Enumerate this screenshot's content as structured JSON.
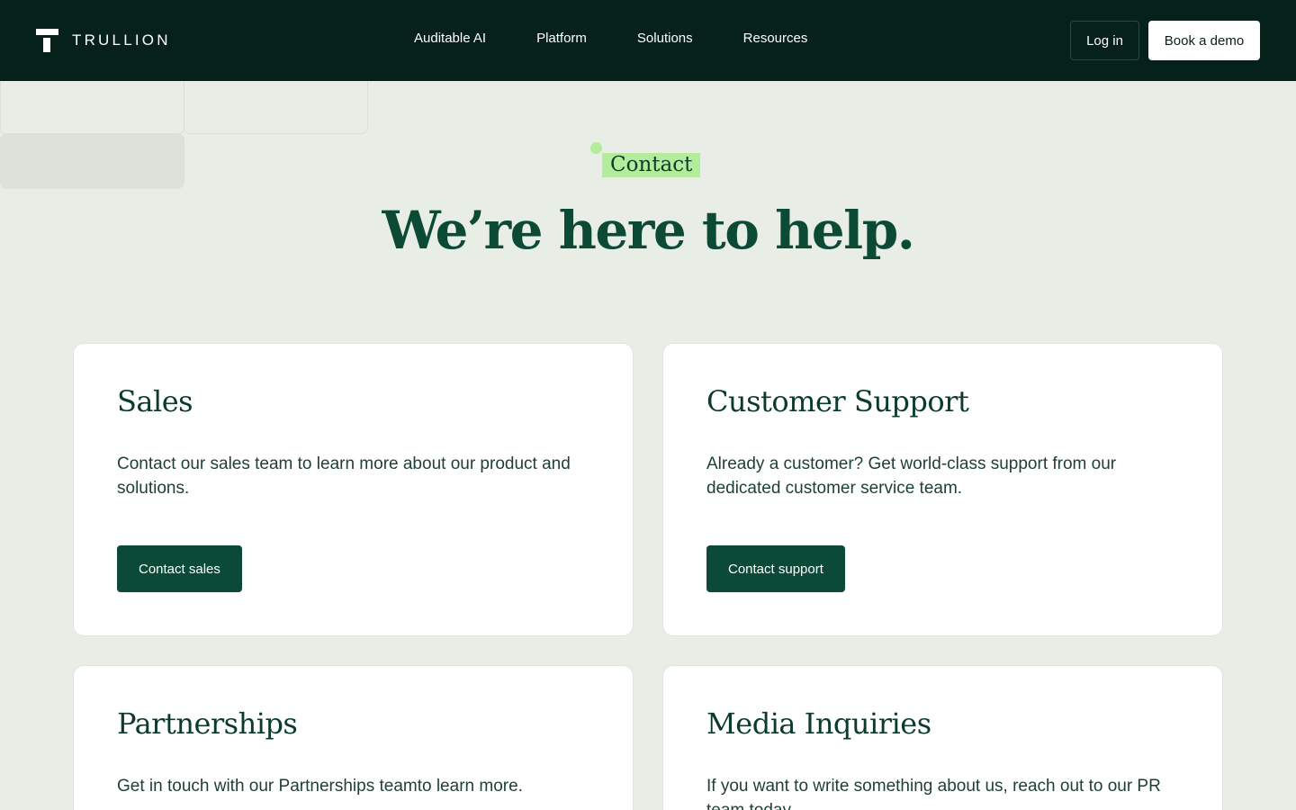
{
  "brand": {
    "name": "TRULLION"
  },
  "nav": {
    "items": [
      "Auditable AI",
      "Platform",
      "Solutions",
      "Resources"
    ],
    "login_label": "Log in",
    "demo_label": "Book a demo"
  },
  "hero": {
    "eyebrow": "Contact",
    "title": "We’re here to help."
  },
  "cards": [
    {
      "title": "Sales",
      "text": "Contact our sales team to learn more about our product and solutions.",
      "cta": "Contact sales"
    },
    {
      "title": "Customer Support",
      "text": "Already a customer? Get world-class support from our dedicated customer service team.",
      "cta": "Contact support"
    },
    {
      "title": "Partnerships",
      "text": "Get in touch with our Partnerships teamto learn more."
    },
    {
      "title": "Media Inquiries",
      "text": "If you want to write something about us, reach out to our PR team today."
    }
  ],
  "colors": {
    "header_bg": "#06201a",
    "page_bg": "#e8ede6",
    "accent_green": "#b3ec9a",
    "button_green": "#0b4a36",
    "heading_green": "#0c4a36"
  }
}
